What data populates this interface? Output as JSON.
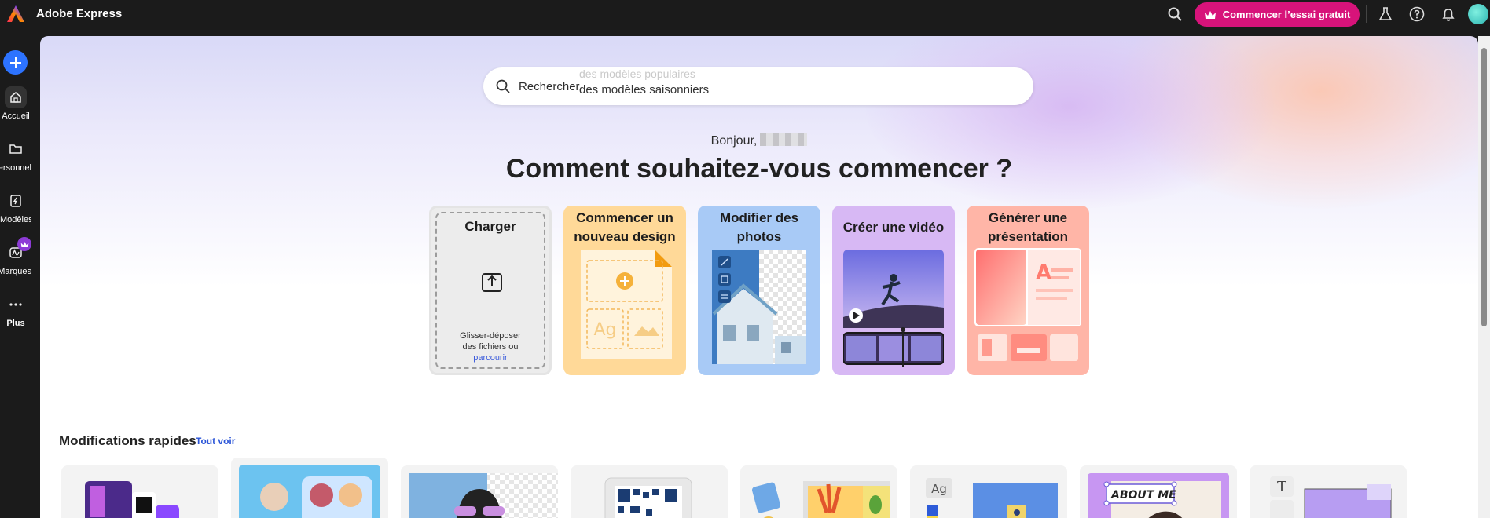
{
  "app": {
    "title": "Adobe Express"
  },
  "header": {
    "trial_label": "Commencer l’essai gratuit",
    "icons": [
      "search-icon",
      "lab-flask-icon",
      "help-icon",
      "bell-icon",
      "avatar"
    ]
  },
  "sidebar": {
    "items": [
      {
        "label": "Accueil",
        "icon": "home-icon"
      },
      {
        "label": "Personnel",
        "icon": "folder-icon"
      },
      {
        "label": "Modèles",
        "icon": "templates-icon"
      },
      {
        "label": "Marques",
        "icon": "brand-icon"
      },
      {
        "label": "Plus",
        "icon": "more-icon"
      }
    ]
  },
  "search": {
    "label": "Rechercher",
    "placeholder_prev": "des modèles populaires",
    "placeholder": "des modèles saisonniers"
  },
  "greeting": {
    "text": "Bonjour,"
  },
  "headline": "Comment souhaitez-vous commencer ?",
  "start_cards": [
    {
      "title": "Charger",
      "hint_line1": "Glisser-déposer",
      "hint_line2": "des fichiers ou",
      "browse": "parcourir"
    },
    {
      "title": "Commencer un nouveau design",
      "tile_text": "Ag"
    },
    {
      "title": "Modifier des photos"
    },
    {
      "title": "Créer une vidéo"
    },
    {
      "title": "Générer une présentation"
    }
  ],
  "quick_actions": {
    "title": "Modifications rapides",
    "see_all": "Tout voir",
    "tile_texts": [
      "Ag",
      "ABOUT ME",
      "T"
    ]
  },
  "colors": {
    "accent_blue": "#2d73ff",
    "trial_pink": "#d7137a",
    "design_card": "#ffd998",
    "photo_card": "#a8caf6",
    "video_card": "#d7b8f4",
    "presentation_card": "#ffb5a7"
  }
}
